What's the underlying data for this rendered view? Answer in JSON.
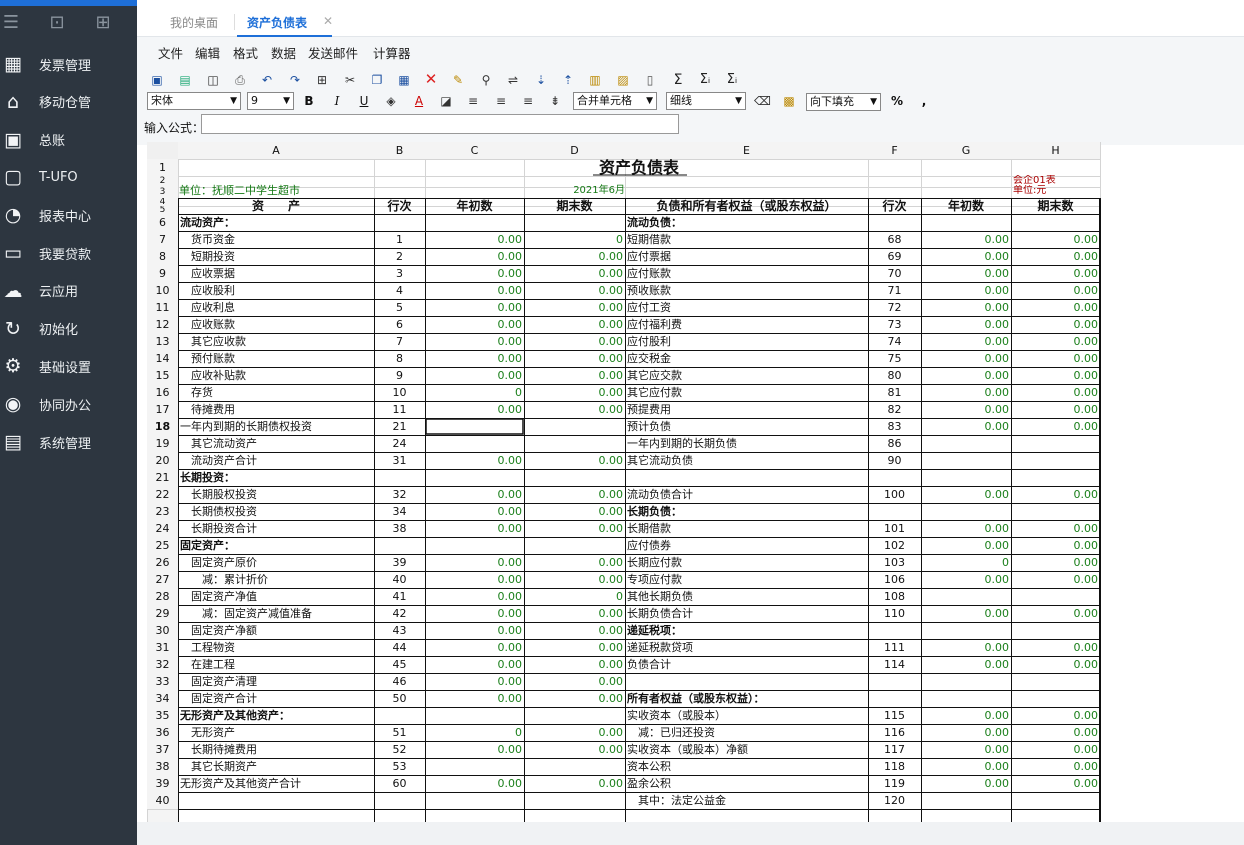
{
  "sidebar": {
    "items": [
      {
        "label": "发票管理",
        "icon": "invoice-icon"
      },
      {
        "label": "移动仓管",
        "icon": "warehouse-icon"
      },
      {
        "label": "总账",
        "icon": "ledger-icon"
      },
      {
        "label": "T-UFO",
        "icon": "ufo-icon"
      },
      {
        "label": "报表中心",
        "icon": "report-icon"
      },
      {
        "label": "我要贷款",
        "icon": "loan-icon"
      },
      {
        "label": "云应用",
        "icon": "cloud-icon"
      },
      {
        "label": "初始化",
        "icon": "init-icon"
      },
      {
        "label": "基础设置",
        "icon": "settings-icon"
      },
      {
        "label": "协同办公",
        "icon": "collab-icon"
      },
      {
        "label": "系统管理",
        "icon": "system-icon"
      }
    ]
  },
  "tabs": [
    {
      "label": "我的桌面"
    },
    {
      "label": "资产负债表",
      "close": "✕"
    }
  ],
  "menu": [
    "文件",
    "编辑",
    "格式",
    "数据",
    "发送邮件",
    "计算器"
  ],
  "toolbar": {
    "font": "宋体",
    "size": "9",
    "merge": "合并单元格",
    "border": "细线",
    "fill": "向下填充",
    "bold": "B",
    "italic": "I",
    "underline": "U",
    "percent": "%",
    "comma": ","
  },
  "formula": {
    "label": "输入公式："
  },
  "sheet": {
    "col_headers": [
      "A",
      "B",
      "C",
      "D",
      "E",
      "F",
      "G",
      "H"
    ],
    "title": "资产负债表",
    "company": "单位：抚顺二中学生超市",
    "period": "2021年6月",
    "form_no": "会企01表",
    "unit": "单位:元",
    "hdr": {
      "a": "资　　产",
      "b": "行次",
      "c": "年初数",
      "d": "期末数",
      "e": "负债和所有者权益（或股东权益）",
      "f": "行次",
      "g": "年初数",
      "h": "期末数"
    },
    "row_numbers": [
      "1",
      "2",
      "3",
      "4",
      "5",
      "6",
      "7",
      "8",
      "9",
      "10",
      "11",
      "12",
      "13",
      "14",
      "15",
      "16",
      "17",
      "18",
      "19",
      "20",
      "21",
      "22",
      "23",
      "24",
      "25",
      "26",
      "27",
      "28",
      "29",
      "30",
      "31",
      "32",
      "33",
      "34",
      "35",
      "36",
      "37",
      "38",
      "39",
      "40"
    ],
    "rows": [
      {
        "a": "流动资产：",
        "ab": 1,
        "b": "",
        "c": "",
        "d": "",
        "e": "流动负债：",
        "eb": 1,
        "f": "",
        "g": "",
        "h": ""
      },
      {
        "a": "　货币资金",
        "b": "1",
        "c": "0.00",
        "d": "0",
        "e": "短期借款",
        "f": "68",
        "g": "0.00",
        "h": "0.00"
      },
      {
        "a": "　短期投资",
        "b": "2",
        "c": "0.00",
        "d": "0.00",
        "e": "应付票据",
        "f": "69",
        "g": "0.00",
        "h": "0.00"
      },
      {
        "a": "　应收票据",
        "b": "3",
        "c": "0.00",
        "d": "0.00",
        "e": "应付账款",
        "f": "70",
        "g": "0.00",
        "h": "0.00"
      },
      {
        "a": "　应收股利",
        "b": "4",
        "c": "0.00",
        "d": "0.00",
        "e": "预收账款",
        "f": "71",
        "g": "0.00",
        "h": "0.00"
      },
      {
        "a": "　应收利息",
        "b": "5",
        "c": "0.00",
        "d": "0.00",
        "e": "应付工资",
        "f": "72",
        "g": "0.00",
        "h": "0.00"
      },
      {
        "a": "　应收账款",
        "b": "6",
        "c": "0.00",
        "d": "0.00",
        "e": "应付福利费",
        "f": "73",
        "g": "0.00",
        "h": "0.00"
      },
      {
        "a": "　其它应收款",
        "b": "7",
        "c": "0.00",
        "d": "0.00",
        "e": "应付股利",
        "f": "74",
        "g": "0.00",
        "h": "0.00"
      },
      {
        "a": "　预付账款",
        "b": "8",
        "c": "0.00",
        "d": "0.00",
        "e": "应交税金",
        "f": "75",
        "g": "0.00",
        "h": "0.00"
      },
      {
        "a": "　应收补贴款",
        "b": "9",
        "c": "0.00",
        "d": "0.00",
        "e": "其它应交款",
        "f": "80",
        "g": "0.00",
        "h": "0.00"
      },
      {
        "a": "　存货",
        "b": "10",
        "c": "0",
        "d": "0.00",
        "e": "其它应付款",
        "f": "81",
        "g": "0.00",
        "h": "0.00"
      },
      {
        "a": "　待摊费用",
        "b": "11",
        "c": "0.00",
        "d": "0.00",
        "e": "预提费用",
        "f": "82",
        "g": "0.00",
        "h": "0.00"
      },
      {
        "a": "一年内到期的长期债权投资",
        "b": "21",
        "c": "",
        "d": "",
        "e": "预计负债",
        "f": "83",
        "g": "0.00",
        "h": "0.00"
      },
      {
        "a": "　其它流动资产",
        "b": "24",
        "c": "",
        "d": "",
        "e": "一年内到期的长期负债",
        "f": "86",
        "g": "",
        "h": ""
      },
      {
        "a": "　流动资产合计",
        "b": "31",
        "c": "0.00",
        "d": "0.00",
        "e": "其它流动负债",
        "f": "90",
        "g": "",
        "h": ""
      },
      {
        "a": "长期投资：",
        "ab": 1,
        "b": "",
        "c": "",
        "d": "",
        "e": "",
        "f": "",
        "g": "",
        "h": ""
      },
      {
        "a": "　长期股权投资",
        "b": "32",
        "c": "0.00",
        "d": "0.00",
        "e": "流动负债合计",
        "f": "100",
        "g": "0.00",
        "h": "0.00"
      },
      {
        "a": "　长期债权投资",
        "b": "34",
        "c": "0.00",
        "d": "0.00",
        "e": "长期负债：",
        "eb": 1,
        "f": "",
        "g": "",
        "h": ""
      },
      {
        "a": "　长期投资合计",
        "b": "38",
        "c": "0.00",
        "d": "0.00",
        "e": "长期借款",
        "f": "101",
        "g": "0.00",
        "h": "0.00"
      },
      {
        "a": "固定资产：",
        "ab": 1,
        "b": "",
        "c": "",
        "d": "",
        "e": "应付债券",
        "f": "102",
        "g": "0.00",
        "h": "0.00"
      },
      {
        "a": "　固定资产原价",
        "b": "39",
        "c": "0.00",
        "d": "0.00",
        "e": "长期应付款",
        "f": "103",
        "g": "0",
        "h": "0.00"
      },
      {
        "a": "　　减：累计折价",
        "b": "40",
        "c": "0.00",
        "d": "0.00",
        "e": "专项应付款",
        "f": "106",
        "g": "0.00",
        "h": "0.00"
      },
      {
        "a": "　固定资产净值",
        "b": "41",
        "c": "0.00",
        "d": "0",
        "e": "其他长期负债",
        "f": "108",
        "g": "",
        "h": ""
      },
      {
        "a": "　　减：固定资产减值准备",
        "b": "42",
        "c": "0.00",
        "d": "0.00",
        "e": "长期负债合计",
        "f": "110",
        "g": "0.00",
        "h": "0.00"
      },
      {
        "a": "　固定资产净额",
        "b": "43",
        "c": "0.00",
        "d": "0.00",
        "e": "递延税项：",
        "eb": 1,
        "f": "",
        "g": "",
        "h": ""
      },
      {
        "a": "　工程物资",
        "b": "44",
        "c": "0.00",
        "d": "0.00",
        "e": "递延税款贷项",
        "f": "111",
        "g": "0.00",
        "h": "0.00"
      },
      {
        "a": "　在建工程",
        "b": "45",
        "c": "0.00",
        "d": "0.00",
        "e": "负债合计",
        "f": "114",
        "g": "0.00",
        "h": "0.00"
      },
      {
        "a": "　固定资产清理",
        "b": "46",
        "c": "0.00",
        "d": "0.00",
        "e": "",
        "f": "",
        "g": "",
        "h": ""
      },
      {
        "a": "　固定资产合计",
        "b": "50",
        "c": "0.00",
        "d": "0.00",
        "e": "所有者权益（或股东权益）：",
        "eb": 1,
        "f": "",
        "g": "",
        "h": ""
      },
      {
        "a": "无形资产及其他资产：",
        "ab": 1,
        "b": "",
        "c": "",
        "d": "",
        "e": "实收资本（或股本）",
        "f": "115",
        "g": "0.00",
        "h": "0.00"
      },
      {
        "a": "　无形资产",
        "b": "51",
        "c": "0",
        "d": "0.00",
        "e": "　减：已归还投资",
        "f": "116",
        "g": "0.00",
        "h": "0.00"
      },
      {
        "a": "　长期待摊费用",
        "b": "52",
        "c": "0.00",
        "d": "0.00",
        "e": "实收资本（或股本）净额",
        "f": "117",
        "g": "0.00",
        "h": "0.00"
      },
      {
        "a": "　其它长期资产",
        "b": "53",
        "c": "",
        "d": "",
        "e": "资本公积",
        "f": "118",
        "g": "0.00",
        "h": "0.00"
      },
      {
        "a": "无形资产及其他资产合计",
        "b": "60",
        "c": "0.00",
        "d": "0.00",
        "e": "盈余公积",
        "f": "119",
        "g": "0.00",
        "h": "0.00"
      },
      {
        "a": "",
        "b": "",
        "c": "",
        "d": "",
        "e": "　其中：法定公益金",
        "f": "120",
        "g": "",
        "h": ""
      }
    ]
  }
}
